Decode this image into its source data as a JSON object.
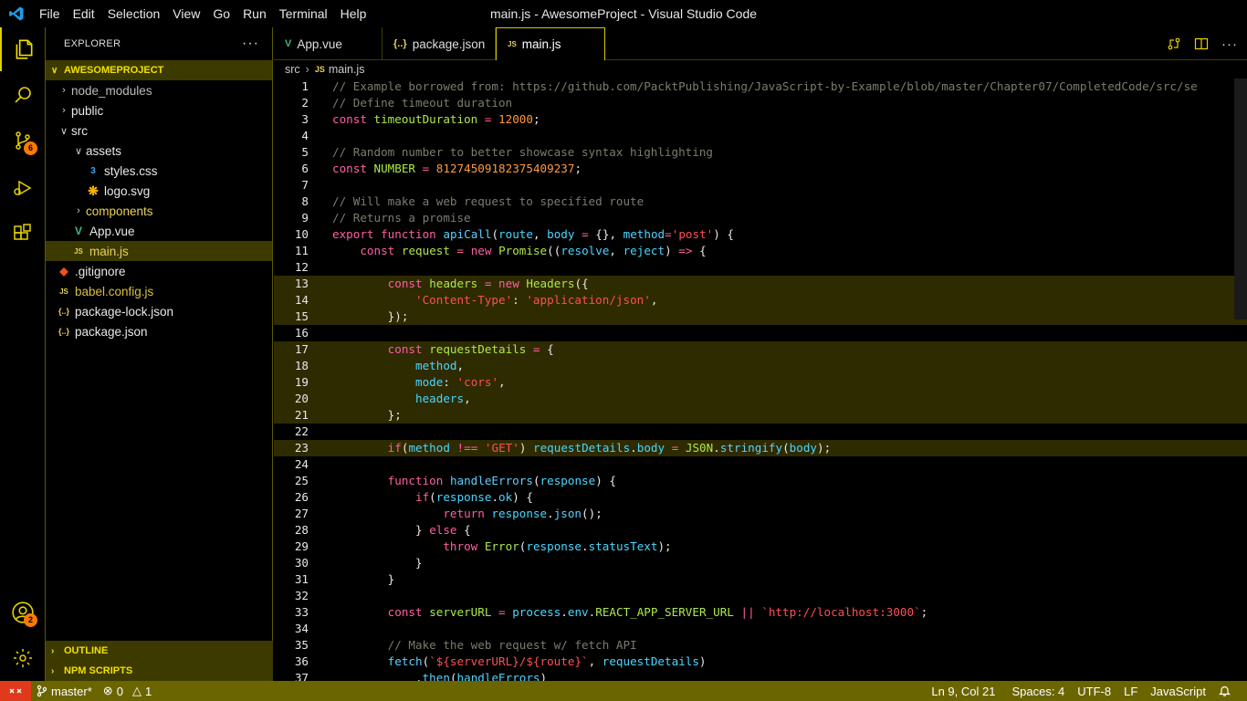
{
  "window": {
    "title": "main.js - AwesomeProject - Visual Studio Code"
  },
  "menu": [
    "File",
    "Edit",
    "Selection",
    "View",
    "Go",
    "Run",
    "Terminal",
    "Help"
  ],
  "activity": {
    "scm_badge": "6",
    "accounts_badge": "2"
  },
  "explorer": {
    "title": "EXPLORER",
    "project": "AWESOMEPROJECT",
    "tree": [
      {
        "label": "node_modules"
      },
      {
        "label": "public"
      },
      {
        "label": "src"
      },
      {
        "label": "assets"
      },
      {
        "label": "styles.css"
      },
      {
        "label": "logo.svg"
      },
      {
        "label": "components"
      },
      {
        "label": "App.vue"
      },
      {
        "label": "main.js"
      },
      {
        "label": ".gitignore"
      },
      {
        "label": "babel.config.js"
      },
      {
        "label": "package-lock.json"
      },
      {
        "label": "package.json"
      }
    ],
    "outline": "OUTLINE",
    "npm_scripts": "NPM SCRIPTS"
  },
  "tabs": [
    {
      "label": "App.vue"
    },
    {
      "label": "package.json"
    },
    {
      "label": "main.js"
    }
  ],
  "breadcrumb": {
    "folder": "src",
    "file": "main.js"
  },
  "code_lines": [
    "// Example borrowed from: https://github.com/PacktPublishing/JavaScript-by-Example/blob/master/Chapter07/CompletedCode/src/se",
    "// Define timeout duration",
    "const timeoutDuration = 12000;",
    "",
    "// Random number to better showcase syntax highlighting",
    "const NUMBER = 812745091823754O9237;",
    "",
    "// Will make a web request to specified route",
    "// Returns a promise",
    "export function apiCall(route, body = {}, method='post') {",
    "  const request = new Promise((resolve, reject) => {",
    "",
    "    const headers = new Headers({",
    "      'Content-Type': 'application/json',",
    "    });",
    "",
    "    const requestDetails = {",
    "      method,",
    "      mode: 'cors',",
    "      headers,",
    "    };",
    "",
    "    if(method !== 'GET') requestDetails.body = JSON.stringify(body);",
    "",
    "    function handleErrors(response) {",
    "      if(response.ok) {",
    "        return response.json();",
    "      } else {",
    "        throw Error(response.statusText);",
    "      }",
    "    }",
    "",
    "    const serverURL = process.env.REACT_APP_SERVER_URL || `http://localhost:3000`;",
    "",
    "    // Make the web request w/ fetch API",
    "    fetch(`${serverURL}/${route}`, requestDetails)",
    "      .then(handleErrors)"
  ],
  "status": {
    "branch": "master*",
    "errors": "0",
    "warnings": "1",
    "position": "Ln 9, Col 21",
    "spaces": "Spaces: 4",
    "encoding": "UTF-8",
    "eol": "LF",
    "language": "JavaScript"
  },
  "colors": {
    "accent": "#f0e000",
    "statusbar": "#6b6500",
    "remote": "#e03a1a",
    "badge": "#ff7a00"
  }
}
